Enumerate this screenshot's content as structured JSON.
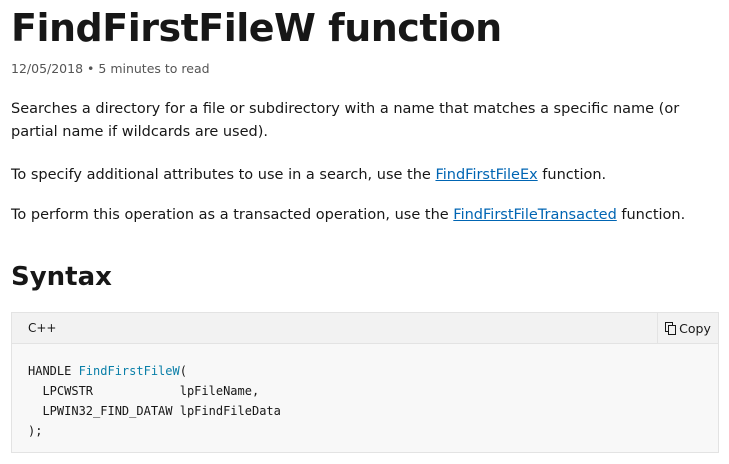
{
  "title": "FindFirstFileW function",
  "meta": {
    "date": "12/05/2018",
    "separator": "•",
    "read_time": "5 minutes to read"
  },
  "paragraphs": {
    "p1": "Searches a directory for a file or subdirectory with a name that matches a specific name (or partial name if wildcards are used).",
    "p2_before": "To specify additional attributes to use in a search, use the ",
    "p2_link": "FindFirstFileEx",
    "p2_after": " function.",
    "p3_before": "To perform this operation as a transacted operation, use the ",
    "p3_link": "FindFirstFileTransacted",
    "p3_after": " function."
  },
  "syntax": {
    "heading": "Syntax",
    "language": "C++",
    "copy_label": "Copy",
    "code": {
      "l1_a": "HANDLE ",
      "l1_fn": "FindFirstFileW",
      "l1_b": "(",
      "l2": "  LPCWSTR            lpFileName,",
      "l3": "  LPWIN32_FIND_DATAW lpFindFileData",
      "l4": ");"
    }
  }
}
